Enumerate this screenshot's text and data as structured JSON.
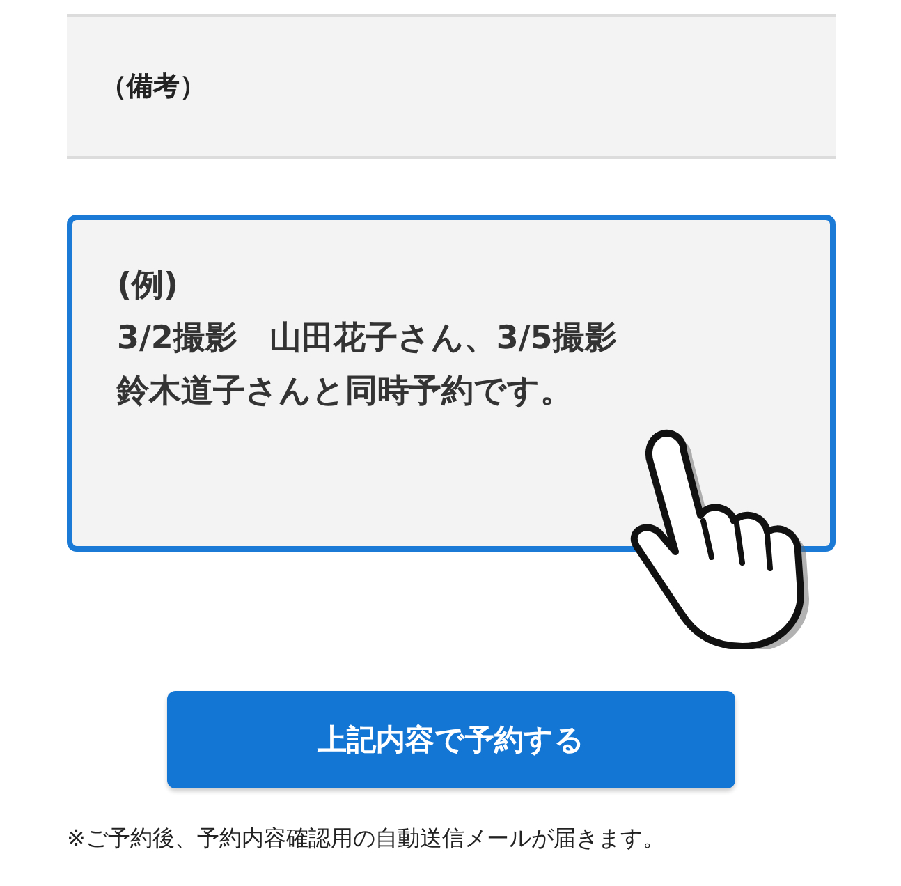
{
  "remarks_header": {
    "label": "（備考）"
  },
  "remarks_field": {
    "placeholder_lines": [
      "(例)",
      "3/2撮影　山田花子さん、3/5撮影",
      "鈴木道子さんと同時予約です。"
    ],
    "focused": true
  },
  "submit_button": {
    "label": "上記内容で予約する"
  },
  "footnote": "※ご予約後、予約内容確認用の自動送信メールが届きます。"
}
